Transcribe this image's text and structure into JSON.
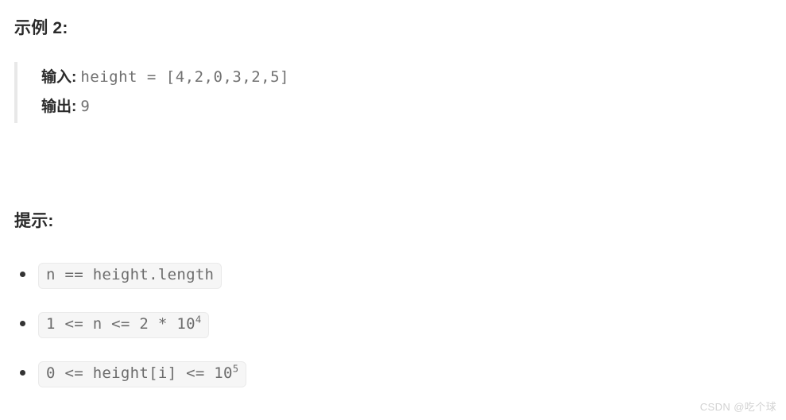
{
  "document": {
    "background_color": "#ffffff",
    "text_color": "#2b2b2b",
    "code_text_color": "#6c6c6c",
    "chip_background_color": "#f6f6f6",
    "chip_border_color": "#eaeaea",
    "quote_border_color": "#e8e8e8",
    "watermark_color": "#d2d2d2"
  },
  "example_section": {
    "heading": "示例 2:",
    "input_label": "输入:",
    "input_value": "height = [4,2,0,3,2,5]",
    "output_label": "输出:",
    "output_value": "9"
  },
  "hints_section": {
    "heading": "提示:",
    "items": [
      {
        "base": "n == height.length",
        "sup": ""
      },
      {
        "base": "1 <= n <= 2 * 10",
        "sup": "4"
      },
      {
        "base": "0 <= height[i] <= 10",
        "sup": "5"
      }
    ]
  },
  "watermark": {
    "text": "CSDN @吃个球"
  }
}
